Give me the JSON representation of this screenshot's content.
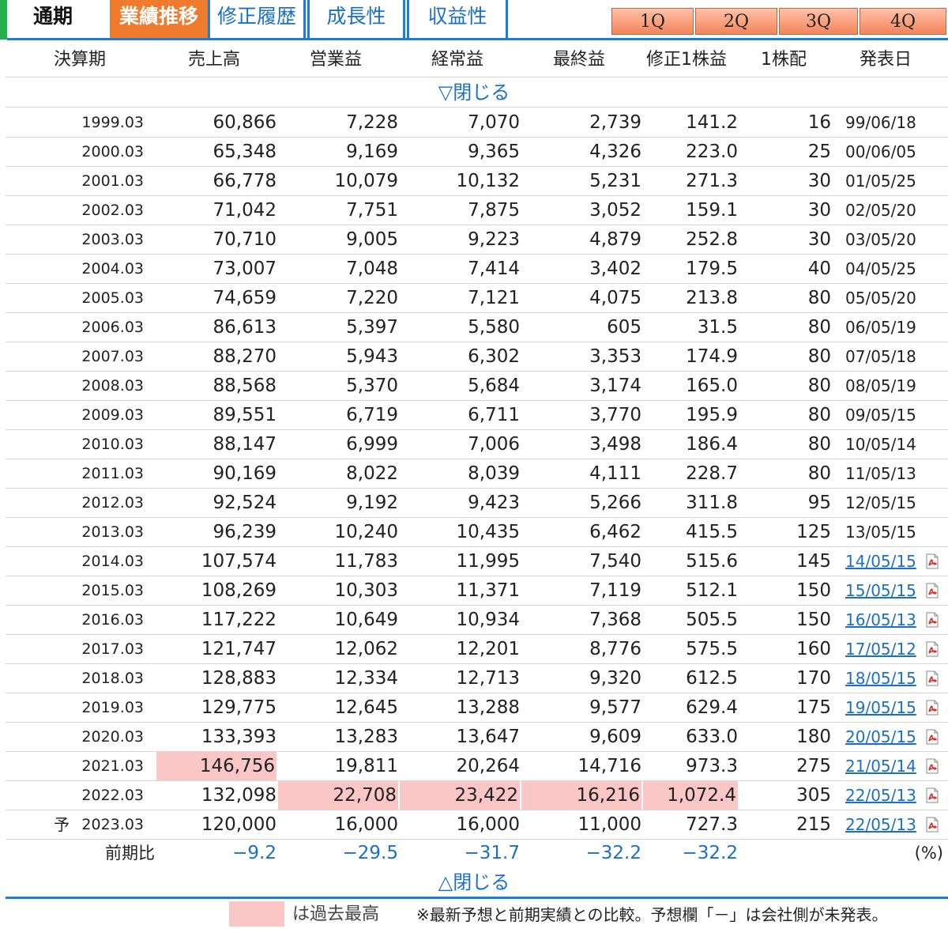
{
  "tabs": {
    "annual": "通期",
    "trend": "業績推移",
    "revision": "修正履歴",
    "growth": "成長性",
    "profitability": "収益性"
  },
  "quarters": [
    "1Q",
    "2Q",
    "3Q",
    "4Q"
  ],
  "columns": [
    "決算期",
    "売上高",
    "営業益",
    "経常益",
    "最終益",
    "修正1株益",
    "1株配",
    "発表日"
  ],
  "close_top": "▽閉じる",
  "close_bottom": "△閉じる",
  "rows": [
    {
      "period": "1999.03",
      "sales": "60,866",
      "op": "7,228",
      "ord": "7,070",
      "net": "2,739",
      "eps": "141.2",
      "div": "16",
      "date": "99/06/18"
    },
    {
      "period": "2000.03",
      "sales": "65,348",
      "op": "9,169",
      "ord": "9,365",
      "net": "4,326",
      "eps": "223.0",
      "div": "25",
      "date": "00/06/05"
    },
    {
      "period": "2001.03",
      "sales": "66,778",
      "op": "10,079",
      "ord": "10,132",
      "net": "5,231",
      "eps": "271.3",
      "div": "30",
      "date": "01/05/25"
    },
    {
      "period": "2002.03",
      "sales": "71,042",
      "op": "7,751",
      "ord": "7,875",
      "net": "3,052",
      "eps": "159.1",
      "div": "30",
      "date": "02/05/20"
    },
    {
      "period": "2003.03",
      "sales": "70,710",
      "op": "9,005",
      "ord": "9,223",
      "net": "4,879",
      "eps": "252.8",
      "div": "30",
      "date": "03/05/20"
    },
    {
      "period": "2004.03",
      "sales": "73,007",
      "op": "7,048",
      "ord": "7,414",
      "net": "3,402",
      "eps": "179.5",
      "div": "40",
      "date": "04/05/25"
    },
    {
      "period": "2005.03",
      "sales": "74,659",
      "op": "7,220",
      "ord": "7,121",
      "net": "4,075",
      "eps": "213.8",
      "div": "80",
      "date": "05/05/20"
    },
    {
      "period": "2006.03",
      "sales": "86,613",
      "op": "5,397",
      "ord": "5,580",
      "net": "605",
      "eps": "31.5",
      "div": "80",
      "date": "06/05/19"
    },
    {
      "period": "2007.03",
      "sales": "88,270",
      "op": "5,943",
      "ord": "6,302",
      "net": "3,353",
      "eps": "174.9",
      "div": "80",
      "date": "07/05/18"
    },
    {
      "period": "2008.03",
      "sales": "88,568",
      "op": "5,370",
      "ord": "5,684",
      "net": "3,174",
      "eps": "165.0",
      "div": "80",
      "date": "08/05/19"
    },
    {
      "period": "2009.03",
      "sales": "89,551",
      "op": "6,719",
      "ord": "6,711",
      "net": "3,770",
      "eps": "195.9",
      "div": "80",
      "date": "09/05/15"
    },
    {
      "period": "2010.03",
      "sales": "88,147",
      "op": "6,999",
      "ord": "7,006",
      "net": "3,498",
      "eps": "186.4",
      "div": "80",
      "date": "10/05/14"
    },
    {
      "period": "2011.03",
      "sales": "90,169",
      "op": "8,022",
      "ord": "8,039",
      "net": "4,111",
      "eps": "228.7",
      "div": "80",
      "date": "11/05/13"
    },
    {
      "period": "2012.03",
      "sales": "92,524",
      "op": "9,192",
      "ord": "9,423",
      "net": "5,266",
      "eps": "311.8",
      "div": "95",
      "date": "12/05/15"
    },
    {
      "period": "2013.03",
      "sales": "96,239",
      "op": "10,240",
      "ord": "10,435",
      "net": "6,462",
      "eps": "415.5",
      "div": "125",
      "date": "13/05/15"
    },
    {
      "period": "2014.03",
      "sales": "107,574",
      "op": "11,783",
      "ord": "11,995",
      "net": "7,540",
      "eps": "515.6",
      "div": "145",
      "date": "14/05/15",
      "link": true
    },
    {
      "period": "2015.03",
      "sales": "108,269",
      "op": "10,303",
      "ord": "11,371",
      "net": "7,119",
      "eps": "512.1",
      "div": "150",
      "date": "15/05/15",
      "link": true
    },
    {
      "period": "2016.03",
      "sales": "117,222",
      "op": "10,649",
      "ord": "10,934",
      "net": "7,368",
      "eps": "505.5",
      "div": "150",
      "date": "16/05/13",
      "link": true
    },
    {
      "period": "2017.03",
      "sales": "121,747",
      "op": "12,062",
      "ord": "12,201",
      "net": "8,776",
      "eps": "575.5",
      "div": "160",
      "date": "17/05/12",
      "link": true
    },
    {
      "period": "2018.03",
      "sales": "128,883",
      "op": "12,334",
      "ord": "12,713",
      "net": "9,320",
      "eps": "612.5",
      "div": "170",
      "date": "18/05/15",
      "link": true
    },
    {
      "period": "2019.03",
      "sales": "129,775",
      "op": "12,645",
      "ord": "13,288",
      "net": "9,577",
      "eps": "629.4",
      "div": "175",
      "date": "19/05/15",
      "link": true
    },
    {
      "period": "2020.03",
      "sales": "133,393",
      "op": "13,283",
      "ord": "13,647",
      "net": "9,609",
      "eps": "633.0",
      "div": "180",
      "date": "20/05/15",
      "link": true
    },
    {
      "period": "2021.03",
      "sales": "146,756",
      "op": "19,811",
      "ord": "20,264",
      "net": "14,716",
      "eps": "973.3",
      "div": "275",
      "date": "21/05/14",
      "link": true,
      "hl": [
        "sales"
      ]
    },
    {
      "period": "2022.03",
      "sales": "132,098",
      "op": "22,708",
      "ord": "23,422",
      "net": "16,216",
      "eps": "1,072.4",
      "div": "305",
      "date": "22/05/13",
      "link": true,
      "hl": [
        "op",
        "ord",
        "net",
        "eps"
      ]
    },
    {
      "period": "2023.03",
      "prefix": "予",
      "sales": "120,000",
      "op": "16,000",
      "ord": "16,000",
      "net": "11,000",
      "eps": "727.3",
      "div": "215",
      "date": "22/05/13",
      "link": true
    }
  ],
  "change_row": {
    "label": "前期比",
    "sales": "−9.2",
    "op": "−29.5",
    "ord": "−31.7",
    "net": "−32.2",
    "eps": "−32.2",
    "unit": "(%)"
  },
  "legend_text": "は過去最高",
  "footnote": "※最新予想と前期実績との比較。予想欄「－」は会社側が未発表。",
  "colors": {
    "record_highlight": "#fbc6c6",
    "accent_blue": "#1a7fd4",
    "active_tab": "#f07a2e",
    "green_strip": "#22b14c"
  },
  "icons": {
    "pdf": "pdf-icon"
  }
}
